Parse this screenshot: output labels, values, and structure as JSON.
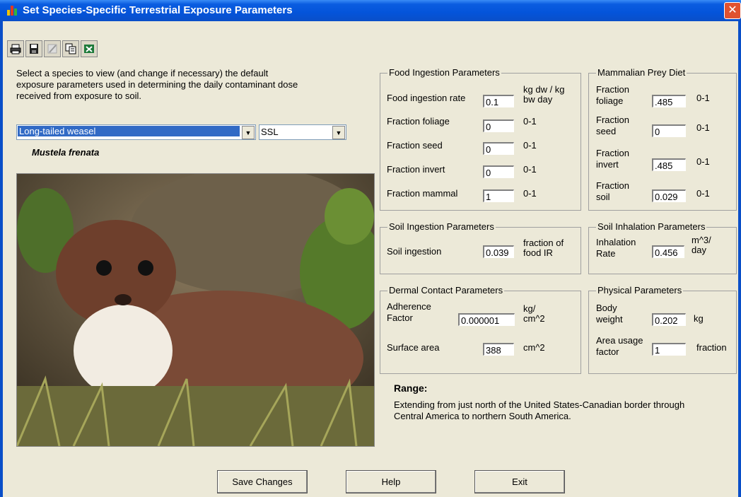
{
  "window": {
    "title": "Set Species-Specific Terrestrial Exposure Parameters",
    "close_label": "✕"
  },
  "toolbar": {
    "icons": [
      "printer-icon",
      "save-disk-icon",
      "edit-icon",
      "copy-icon",
      "excel-icon"
    ]
  },
  "intro": "Select a species to view (and change if necessary) the default exposure parameters used in determining the daily contaminant dose received from exposure to soil.",
  "species": {
    "selected": "Long-tailed weasel",
    "scientific": "Mustela frenata"
  },
  "type_select": {
    "selected": "SSL"
  },
  "food": {
    "title": "Food Ingestion Parameters",
    "rate_label": "Food ingestion rate",
    "rate_value": "0.1",
    "rate_unit": "kg dw / kg bw day",
    "foliage_label": "Fraction foliage",
    "foliage_value": "0",
    "foliage_unit": "0-1",
    "seed_label": "Fraction seed",
    "seed_value": "0",
    "seed_unit": "0-1",
    "invert_label": "Fraction invert",
    "invert_value": "0",
    "invert_unit": "0-1",
    "mammal_label": "Fraction mammal",
    "mammal_value": "1",
    "mammal_unit": "0-1"
  },
  "prey": {
    "title": "Mammalian Prey Diet",
    "foliage_label": "Fraction foliage",
    "foliage_value": ".485",
    "foliage_unit": "0-1",
    "seed_label": "Fraction seed",
    "seed_value": "0",
    "seed_unit": "0-1",
    "invert_label": "Fraction invert",
    "invert_value": ".485",
    "invert_unit": "0-1",
    "soil_label": "Fraction soil",
    "soil_value": "0.029",
    "soil_unit": "0-1"
  },
  "soil_ing": {
    "title": "Soil Ingestion Parameters",
    "label": "Soil ingestion",
    "value": "0.039",
    "unit": "fraction of food IR"
  },
  "soil_inh": {
    "title": "Soil Inhalation Parameters",
    "label": "Inhalation Rate",
    "value": "0.456",
    "unit": "m^3/ day"
  },
  "dermal": {
    "title": "Dermal Contact Parameters",
    "adh_label": "Adherence Factor",
    "adh_value": "0.000001",
    "adh_unit": "kg/ cm^2",
    "area_label": "Surface area",
    "area_value": "388",
    "area_unit": "cm^2"
  },
  "physical": {
    "title": "Physical Parameters",
    "bw_label": "Body weight",
    "bw_value": "0.202",
    "bw_unit": "kg",
    "auf_label": "Area usage factor",
    "auf_value": "1",
    "auf_unit": "fraction"
  },
  "range": {
    "heading": "Range:",
    "text": "Extending from just north of the United States-Canadian border through Central America to northern South America."
  },
  "buttons": {
    "save": "Save Changes",
    "help": "Help",
    "exit": "Exit"
  },
  "colors": {
    "titlebar": "#0454da",
    "selection": "#316ac5",
    "window_bg": "#ECE9D8"
  }
}
